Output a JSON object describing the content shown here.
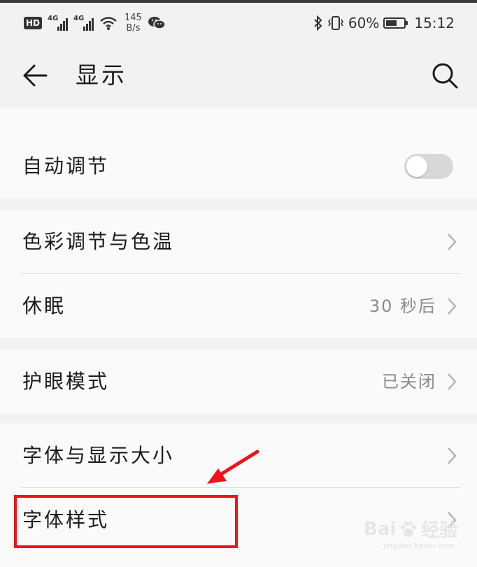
{
  "status_bar": {
    "hd": "HD",
    "signal1_label": "4G",
    "signal2_label": "4G",
    "speed_value": "145",
    "speed_unit": "B/s",
    "battery_text": "60%",
    "battery_level": 0.6,
    "time": "15:12",
    "icons": [
      "hd-icon",
      "signal-icon",
      "wifi-icon",
      "wechat-icon",
      "bluetooth-icon",
      "vibrate-icon",
      "battery-icon"
    ]
  },
  "header": {
    "title": "显示",
    "back_icon": "arrow-left-icon",
    "search_icon": "search-icon"
  },
  "cards": [
    {
      "rows": [
        {
          "label": "自动调节",
          "control": "toggle",
          "toggle_on": false
        }
      ]
    },
    {
      "rows": [
        {
          "label": "色彩调节与色温",
          "control": "chevron"
        },
        {
          "label": "休眠",
          "value": "30 秒后",
          "control": "chevron"
        }
      ]
    },
    {
      "rows": [
        {
          "label": "护眼模式",
          "value": "已关闭",
          "control": "chevron"
        }
      ]
    },
    {
      "rows": [
        {
          "label": "字体与显示大小",
          "control": "chevron"
        },
        {
          "label": "字体样式",
          "control": "chevron"
        }
      ]
    }
  ],
  "annotation": {
    "highlight_color": "#f0141a",
    "target": "字体样式"
  },
  "watermark": {
    "brand": "Bai",
    "brand2": "经验",
    "url": "jingyan.baidu.com"
  }
}
